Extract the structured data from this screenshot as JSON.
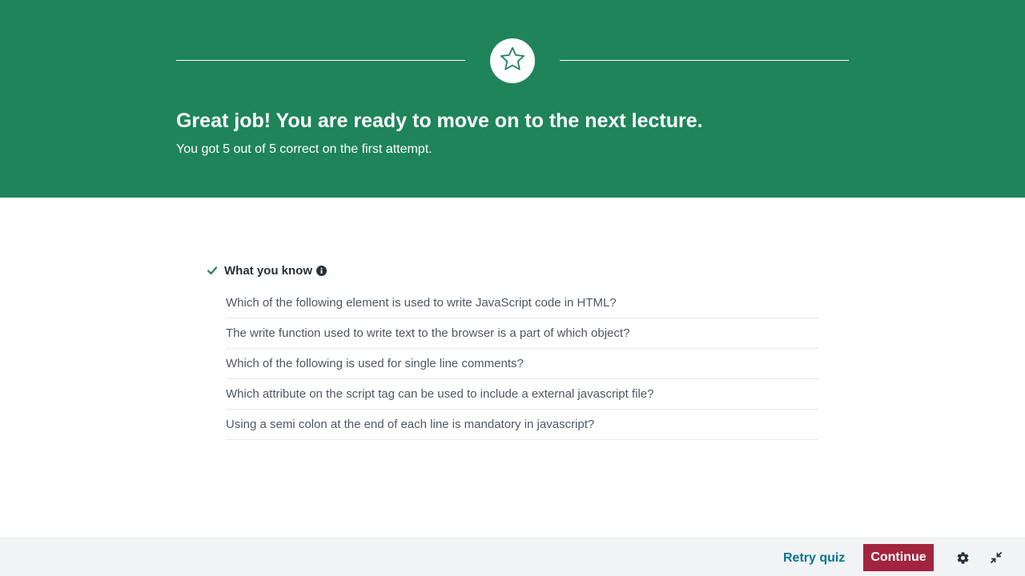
{
  "banner": {
    "title": "Great job! You are ready to move on to the next lecture.",
    "subtitle": "You got 5 out of 5 correct on the first attempt.",
    "icon": "star-icon",
    "color": "#1f845a"
  },
  "know": {
    "title": "What you know",
    "check_icon": "check-icon",
    "info_icon": "info-icon",
    "questions": [
      "Which of the following element is used to write JavaScript code in HTML?",
      "The write function used to write text to the browser is a part of which object?",
      "Which of the following is used for single line comments?",
      "Which attribute on the script tag can be used to include a external javascript file?",
      "Using a semi colon at the end of each line is mandatory in javascript?"
    ]
  },
  "footer": {
    "retry_label": "Retry quiz",
    "continue_label": "Continue",
    "continue_color": "#a3243e",
    "settings_icon": "gear-icon",
    "collapse_icon": "collapse-icon"
  }
}
